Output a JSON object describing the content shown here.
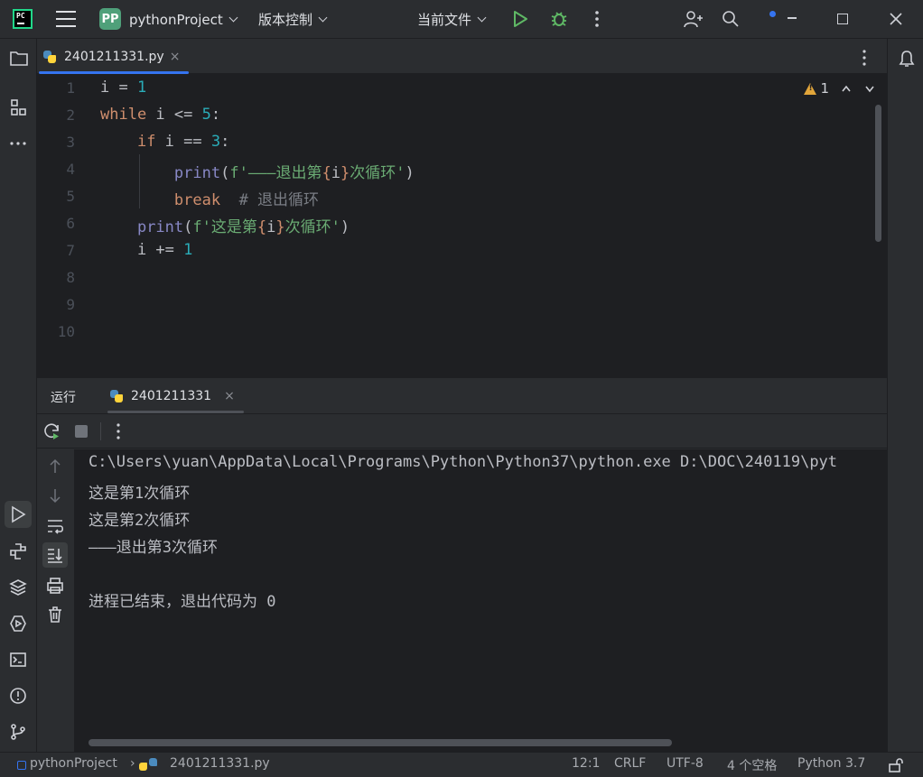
{
  "titlebar": {
    "project_badge": "PP",
    "project_name": "pythonProject",
    "vcs_label": "版本控制",
    "run_config": "当前文件"
  },
  "editor_tab": {
    "filename": "2401211331.py",
    "close": "×"
  },
  "editor": {
    "warning_count": "1",
    "line_numbers": [
      "1",
      "2",
      "3",
      "4",
      "5",
      "6",
      "7",
      "8",
      "9",
      "10"
    ],
    "lines": [
      "i = 1",
      "while i <= 5:",
      "    if i == 3:",
      "        print(f'———退出第{i}次循环')",
      "        break  # 退出循环",
      "    print(f'这是第{i}次循环')",
      "    i += 1"
    ]
  },
  "run_panel": {
    "tab_run": "运行",
    "tab_config": "2401211331",
    "close": "×",
    "output": [
      "C:\\Users\\yuan\\AppData\\Local\\Programs\\Python\\Python37\\python.exe D:\\DOC\\240119\\pyt",
      "这是第1次循环",
      "这是第2次循环",
      "———退出第3次循环",
      "",
      "进程已结束，退出代码为 0"
    ]
  },
  "statusbar": {
    "project": "pythonProject",
    "file": "2401211331.py",
    "position": "12:1",
    "line_sep": "CRLF",
    "encoding": "UTF-8",
    "indent": "4 个空格",
    "interpreter": "Python 3.7"
  },
  "colors": {
    "accent": "#3574f0",
    "keyword": "#cf8e6d",
    "number": "#2aacb8",
    "string": "#6aab73",
    "builtin": "#8888c6",
    "run_green": "#5fb865"
  }
}
